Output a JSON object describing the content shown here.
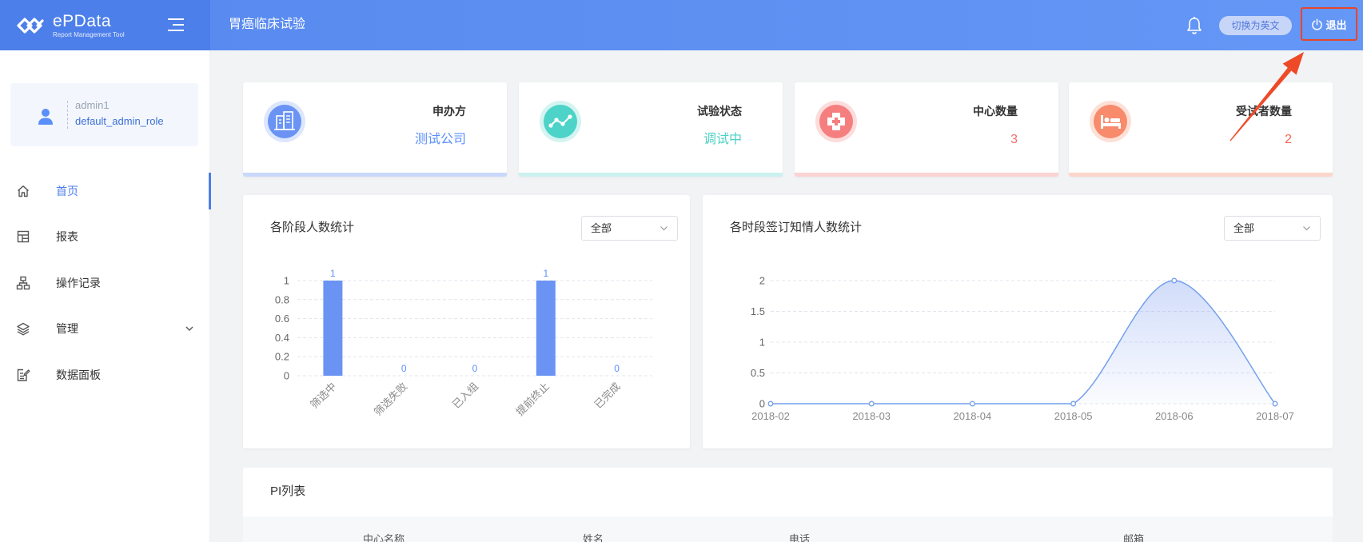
{
  "app": {
    "logo_name": "ePData",
    "logo_sub": "Report Management Tool",
    "title": "胃癌临床试验"
  },
  "header": {
    "lang_switch": "切换为英文",
    "logout": "退出",
    "icons": [
      "menu-toggle-icon",
      "bell-icon",
      "power-icon"
    ]
  },
  "user": {
    "name": "admin1",
    "role": "default_admin_role"
  },
  "sidebar": {
    "items": [
      {
        "label": "首页",
        "icon": "home-icon",
        "active": true
      },
      {
        "label": "报表",
        "icon": "report-icon"
      },
      {
        "label": "操作记录",
        "icon": "sitemap-icon"
      },
      {
        "label": "管理",
        "icon": "layers-icon",
        "expandable": true
      },
      {
        "label": "数据面板",
        "icon": "edit-panel-icon"
      }
    ]
  },
  "stats": [
    {
      "label": "申办方",
      "value": "测试公司",
      "icon": "building-icon",
      "accent": "#6a93f4",
      "value_color": "#5b8ff9",
      "border": "#c9d8fb"
    },
    {
      "label": "试验状态",
      "value": "调试中",
      "icon": "trend-icon",
      "accent": "#4dd3c8",
      "value_color": "#4fd1c5",
      "border": "#caf1ef"
    },
    {
      "label": "中心数量",
      "value": "3",
      "icon": "hospital-icon",
      "accent": "#f57f7f",
      "value_color": "#f56c6c",
      "border": "#fbd3d3"
    },
    {
      "label": "受试者数量",
      "value": "2",
      "icon": "bed-icon",
      "accent": "#f78b6c",
      "value_color": "#f5674f",
      "border": "#fcd6cb"
    }
  ],
  "filters": {
    "stage": "全部",
    "consent": "全部"
  },
  "chart_data": [
    {
      "type": "bar",
      "title": "各阶段人数统计",
      "categories": [
        "筛选中",
        "筛选失败",
        "已入组",
        "提前终止",
        "已完成"
      ],
      "values": [
        1,
        0,
        0,
        1,
        0
      ],
      "yticks": [
        0,
        0.2,
        0.4,
        0.6,
        0.8,
        1
      ],
      "ylim": [
        0,
        1
      ],
      "data_labels": true,
      "grid": true,
      "color": "#6a93f4"
    },
    {
      "type": "line",
      "title": "各时段签订知情人数统计",
      "x": [
        "2018-02",
        "2018-03",
        "2018-04",
        "2018-05",
        "2018-06",
        "2018-07"
      ],
      "values": [
        0,
        0,
        0,
        0,
        2,
        0
      ],
      "yticks": [
        0,
        0.5,
        1,
        1.5,
        2
      ],
      "ylim": [
        0,
        2
      ],
      "smooth": true,
      "area": true,
      "grid": true,
      "color": "#74a0ec"
    }
  ],
  "pi_table": {
    "title": "PI列表",
    "columns": [
      "中心名称",
      "姓名",
      "电话",
      "邮箱"
    ]
  },
  "annotation": {
    "arrow_color": "#ee4a28",
    "highlight": "logout"
  }
}
